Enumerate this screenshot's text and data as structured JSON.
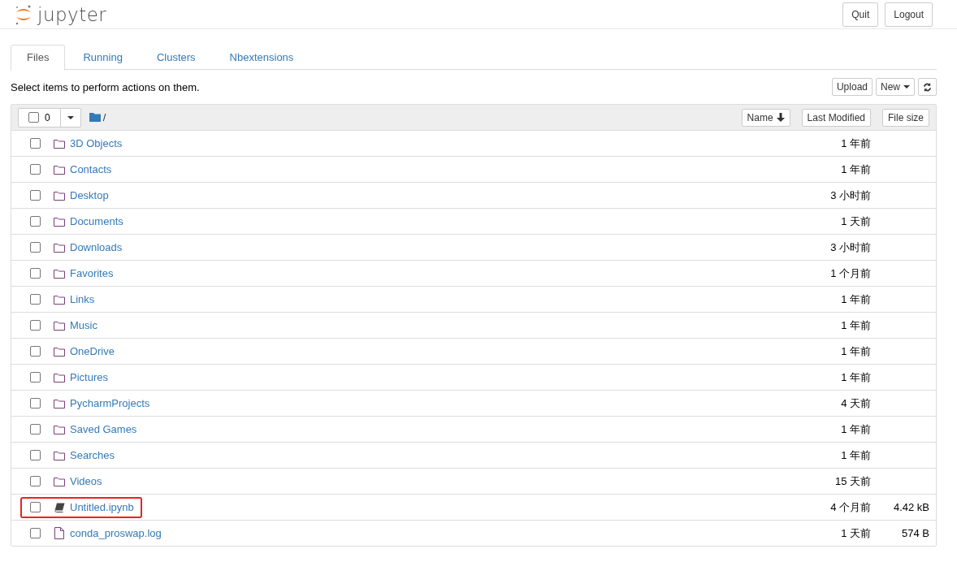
{
  "header": {
    "logo_text": "jupyter",
    "buttons": [
      "Quit",
      "Logout"
    ]
  },
  "tabs": [
    {
      "label": "Files",
      "selected": true
    },
    {
      "label": "Running",
      "selected": false
    },
    {
      "label": "Clusters",
      "selected": false
    },
    {
      "label": "Nbextensions",
      "selected": false
    }
  ],
  "hint": "Select items to perform actions on them.",
  "toolbar": {
    "upload": "Upload",
    "new": "New"
  },
  "list_header": {
    "all_checked": false,
    "selected_count": "0",
    "path": "/",
    "sort_columns": [
      "Name",
      "Last Modified",
      "File size"
    ]
  },
  "rows": [
    {
      "kind": "folder",
      "name": "3D Objects",
      "modified": "1 年前",
      "checked": false,
      "highlighted": false
    },
    {
      "kind": "folder",
      "name": "Contacts",
      "modified": "1 年前",
      "checked": false,
      "highlighted": false
    },
    {
      "kind": "folder",
      "name": "Desktop",
      "modified": "3 小时前",
      "checked": false,
      "highlighted": false
    },
    {
      "kind": "folder",
      "name": "Documents",
      "modified": "1 天前",
      "checked": false,
      "highlighted": false
    },
    {
      "kind": "folder",
      "name": "Downloads",
      "modified": "3 小时前",
      "checked": false,
      "highlighted": false
    },
    {
      "kind": "folder",
      "name": "Favorites",
      "modified": "1 个月前",
      "checked": false,
      "highlighted": false
    },
    {
      "kind": "folder",
      "name": "Links",
      "modified": "1 年前",
      "checked": false,
      "highlighted": false
    },
    {
      "kind": "folder",
      "name": "Music",
      "modified": "1 年前",
      "checked": false,
      "highlighted": false
    },
    {
      "kind": "folder",
      "name": "OneDrive",
      "modified": "1 年前",
      "checked": false,
      "highlighted": false
    },
    {
      "kind": "folder",
      "name": "Pictures",
      "modified": "1 年前",
      "checked": false,
      "highlighted": false
    },
    {
      "kind": "folder",
      "name": "PycharmProjects",
      "modified": "4 天前",
      "checked": false,
      "highlighted": false
    },
    {
      "kind": "folder",
      "name": "Saved Games",
      "modified": "1 年前",
      "checked": false,
      "highlighted": false
    },
    {
      "kind": "folder",
      "name": "Searches",
      "modified": "1 年前",
      "checked": false,
      "highlighted": false
    },
    {
      "kind": "folder",
      "name": "Videos",
      "modified": "15 天前",
      "checked": false,
      "highlighted": false
    },
    {
      "kind": "notebook",
      "name": "Untitled.ipynb",
      "modified": "4 个月前",
      "size": "4.42 kB",
      "checked": false,
      "highlighted": true
    },
    {
      "kind": "file",
      "name": "conda_proswap.log",
      "modified": "1 天前",
      "size": "574 B",
      "checked": false,
      "highlighted": false
    }
  ]
}
